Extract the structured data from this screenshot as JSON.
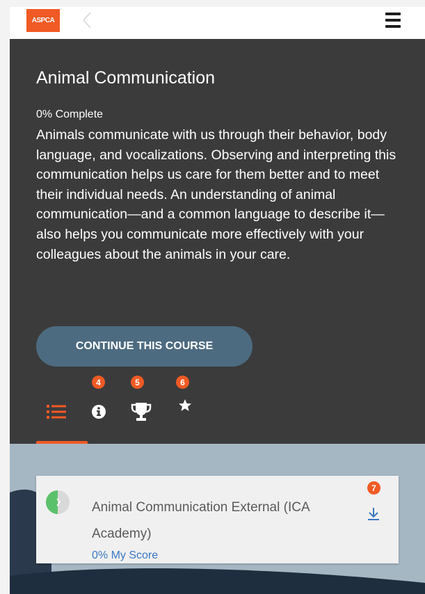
{
  "header": {
    "logo_text": "ASPCA",
    "back_icon": "chevron-left-icon",
    "menu_icon": "hamburger-menu-icon"
  },
  "course": {
    "title": "Animal Communication",
    "progress_text": "0% Complete",
    "description": "Animals communicate with us through their behavior, body language, and vocalizations. Observing and interpreting this communication helps us care for them better and to meet their individual needs. An understanding of animal communication—and a common language to describe it—also helps you communicate more effectively with your colleagues about the animals in your care.",
    "cta_label": "CONTINUE THIS COURSE"
  },
  "tabs": [
    {
      "icon": "list-icon",
      "badge": "",
      "active": true
    },
    {
      "icon": "info-icon",
      "badge": "4",
      "active": false
    },
    {
      "icon": "trophy-icon",
      "badge": "5",
      "active": false
    },
    {
      "icon": "star-icon",
      "badge": "6",
      "active": false
    }
  ],
  "module": {
    "title": "Animal Communication External (ICA Academy)",
    "score_text": "0% My Score",
    "badge": "7",
    "progress_fraction": 0.0,
    "download_icon": "download-icon"
  },
  "colors": {
    "accent": "#f05a24",
    "hero_bg": "#3b3b3c",
    "button_bg": "#4d6b80",
    "link": "#3a78c4",
    "lower_bg": "#a6b7c4"
  }
}
